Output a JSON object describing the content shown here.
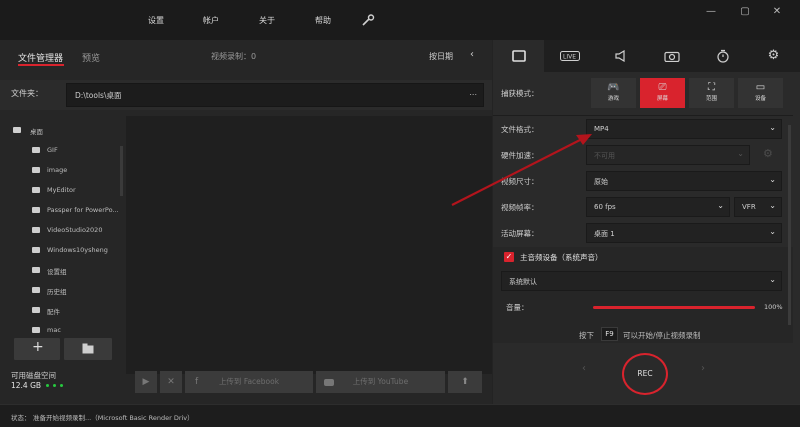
{
  "menu": {
    "settings": "设置",
    "account": "帐户",
    "about": "关于",
    "help": "帮助"
  },
  "window": {
    "minimize": "—",
    "restore": "▢",
    "close": "✕"
  },
  "left": {
    "tab_file_manager": "文件管理器",
    "tab_preview": "预览",
    "video_recording_label": "视频录制：0",
    "sort_label": "按日期",
    "folder_label": "文件夹：",
    "folder_path": "D:\\tools\\桌面",
    "folder_more": "...",
    "tree_root": "桌面",
    "tree_items": [
      "GIF",
      "image",
      "MyEditor",
      "Passper for PowerPo...",
      "VideoStudio2020",
      "Windows10ysheng",
      "设置组",
      "历史组",
      "配件",
      "mac"
    ],
    "add_button": "+",
    "disk_label": "可用磁盘空间",
    "disk_value": "12.4 GB",
    "upload_facebook": "上传到 Facebook",
    "upload_youtube": "上传到 YouTube"
  },
  "status": {
    "prefix": "状态：",
    "text": "准备开始视频录制...（Microsoft Basic Render Driv）"
  },
  "right": {
    "capture_mode_label": "捕获模式：",
    "capture_modes": [
      "游戏",
      "屏幕",
      "范围",
      "设备"
    ],
    "format_label": "文件格式：",
    "format_value": "MP4",
    "hw_accel_label": "硬件加速：",
    "hw_accel_value": "不可用",
    "video_size_label": "视频尺寸：",
    "video_size_value": "原始",
    "fps_label": "视频帧率：",
    "fps_value": "60 fps",
    "vfr_value": "VFR",
    "active_screen_label": "活动屏幕：",
    "active_screen_value": "桌面 1",
    "audio_checkbox_label": "主音频设备（系统声音）",
    "audio_device_value": "系统默认",
    "volume_label": "音量：",
    "volume_value": "100%",
    "hotkey_prefix": "按下",
    "hotkey_key": "F9",
    "hotkey_suffix": "可以开始/停止视频录制",
    "rec_label": "REC",
    "prev_arrow": "‹",
    "next_arrow": "›"
  },
  "colors": {
    "accent": "#d9232d",
    "bg": "#232323",
    "panel": "#2a2a2a",
    "arrow": "#b3141c"
  }
}
